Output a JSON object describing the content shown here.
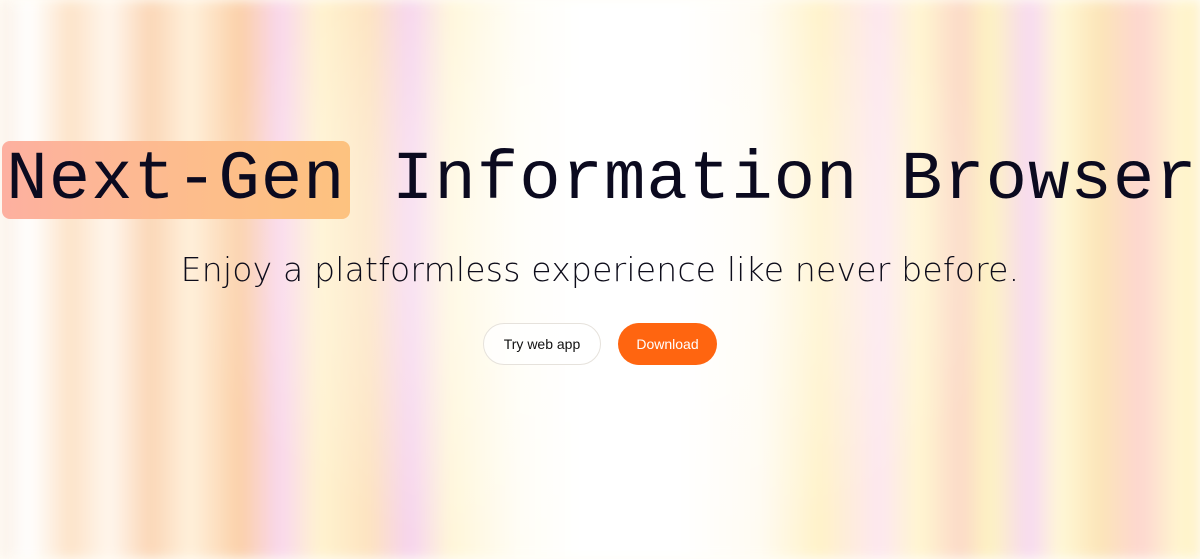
{
  "hero": {
    "headline_highlight": "Next-Gen",
    "headline_rest": " Information Browser",
    "subtitle": "Enjoy a platformless experience like never before."
  },
  "actions": {
    "try_web_app_label": "Try web app",
    "download_label": "Download"
  },
  "colors": {
    "accent": "#ff6510",
    "highlight_start": "#fdb0a0",
    "highlight_end": "#fdc27f",
    "text": "#0b0a1f"
  }
}
